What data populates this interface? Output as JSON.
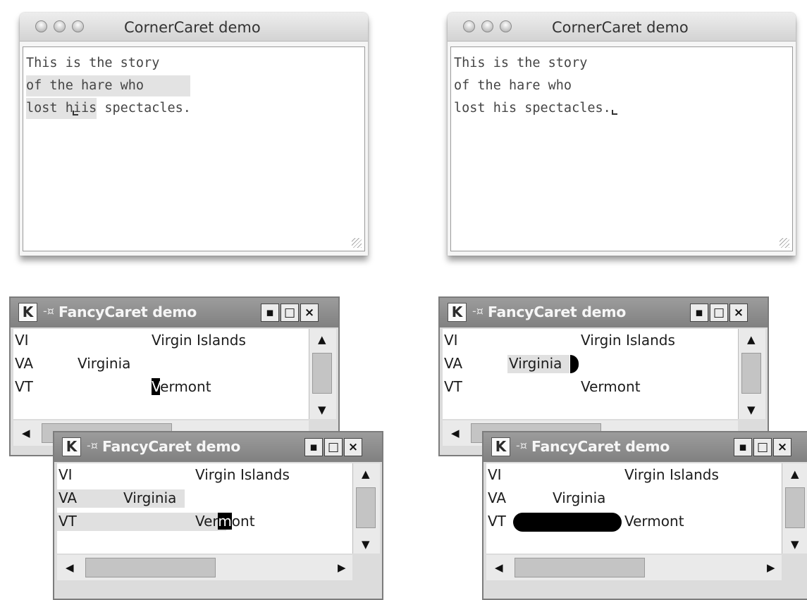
{
  "mac_windows": [
    {
      "title": "CornerCaret demo",
      "lines": [
        "This is the story",
        "of the hare who",
        "lost h",
        "is spectacles."
      ],
      "caret_char": "i"
    },
    {
      "title": "CornerCaret demo",
      "lines": [
        "This is the story",
        "of the hare who",
        "lost his spectacles."
      ]
    }
  ],
  "kde_windows": [
    {
      "title": "FancyCaret demo",
      "rows": [
        {
          "code": "VI",
          "name": "Virgin Islands"
        },
        {
          "code": "VA",
          "name": "Virginia"
        },
        {
          "code": "VT",
          "name": "Vermont"
        }
      ],
      "caret_text": "V",
      "rest_text": "ermont"
    },
    {
      "title": "FancyCaret demo",
      "rows": [
        {
          "code": "VI",
          "name": "Virgin Islands"
        },
        {
          "code": "VA",
          "name": "Virginia"
        },
        {
          "code": "VT",
          "name": "Vermont"
        }
      ]
    },
    {
      "title": "FancyCaret demo",
      "rows": [
        {
          "code": "VI",
          "name": "Virgin Islands"
        },
        {
          "code": "VA",
          "name": "Virginia"
        },
        {
          "code": "VT",
          "name": "Vermont"
        }
      ],
      "pre_text": "Ver",
      "caret_text": "m",
      "rest_text": "ont"
    },
    {
      "title": "FancyCaret demo",
      "rows": [
        {
          "code": "VI",
          "name": "Virgin Islands"
        },
        {
          "code": "VA",
          "name": "Virginia"
        },
        {
          "code": "VT",
          "name": "Vermont"
        }
      ]
    }
  ],
  "icons": {
    "kde_app": "K",
    "pin": "-¤",
    "minimize": "▪",
    "maximize": "□",
    "close": "×",
    "up": "▲",
    "down": "▼",
    "left": "◀",
    "right": "▶"
  }
}
